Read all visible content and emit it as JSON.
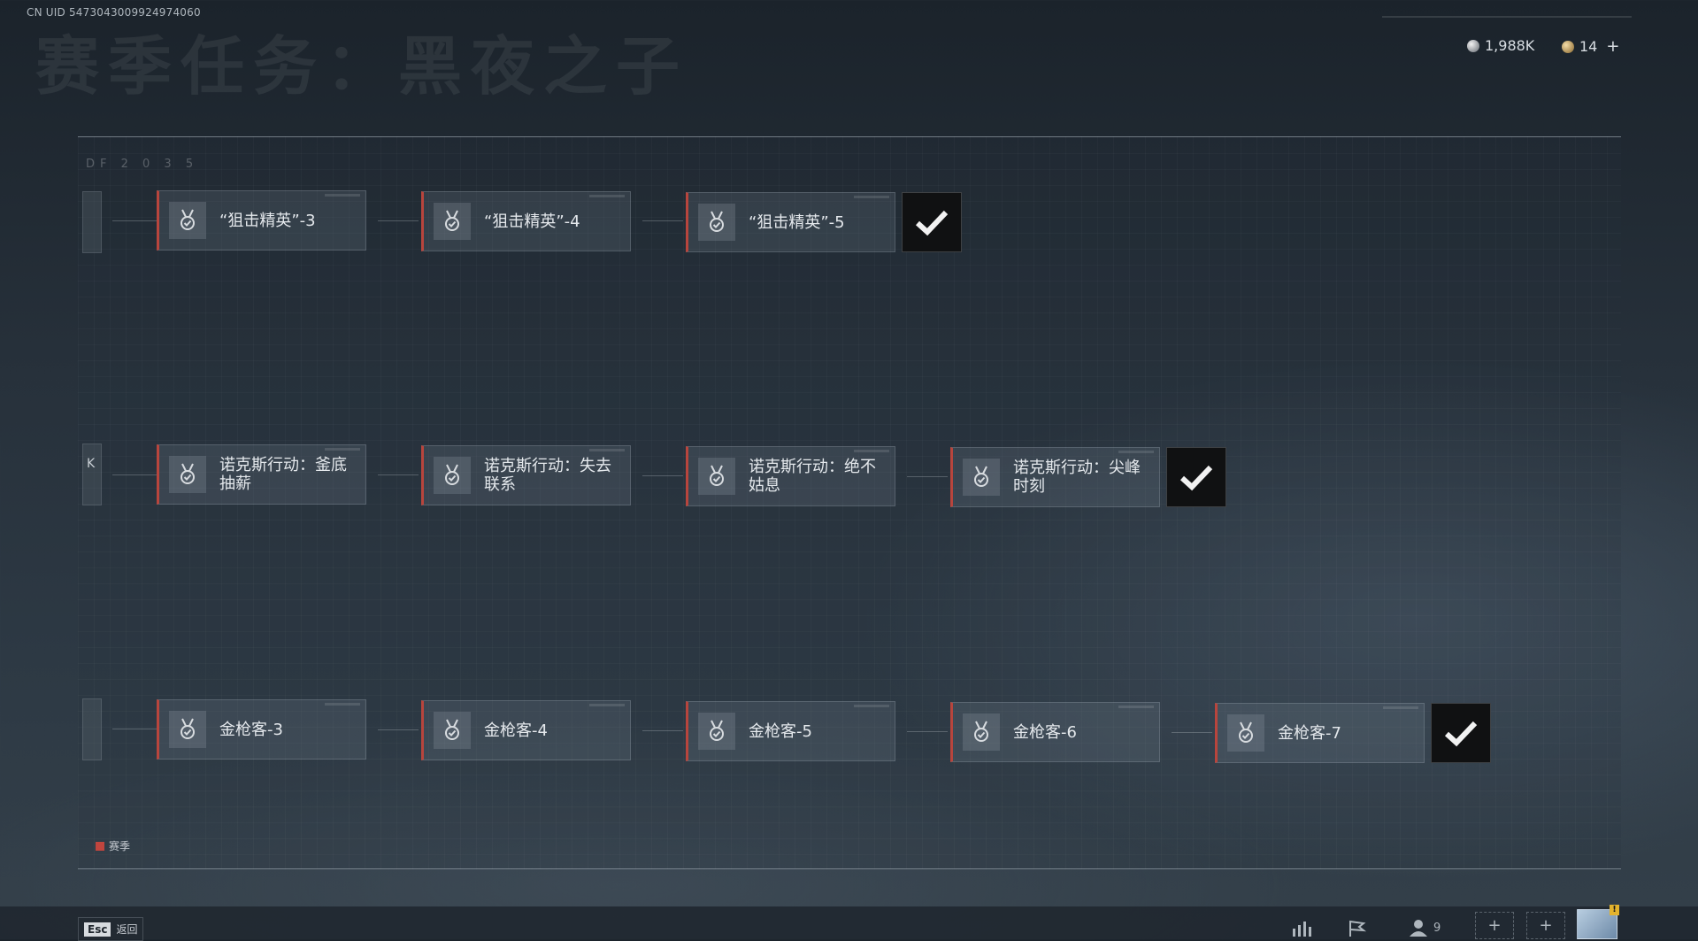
{
  "header": {
    "uid": "CN UID 5473043009924974060",
    "title": "赛季任务：黑夜之子",
    "currency": [
      {
        "icon": "silver-coin-icon",
        "value": "1,988K"
      },
      {
        "icon": "gold-coin-icon",
        "value": "14",
        "add": "+"
      }
    ]
  },
  "panel": {
    "df_code": "DF 2 0 3 5"
  },
  "rows": [
    {
      "stub": "",
      "tasks": [
        {
          "label": "“狙击精英”-3",
          "icon": "medal-check-icon"
        },
        {
          "label": "“狙击精英”-4",
          "icon": "medal-check-icon"
        },
        {
          "label": "“狙击精英”-5",
          "icon": "medal-check-icon"
        }
      ],
      "completed_icon": "checkmark-icon"
    },
    {
      "stub": "K",
      "tasks": [
        {
          "label": "诺克斯行动：釜底抽薪",
          "icon": "medal-check-icon"
        },
        {
          "label": "诺克斯行动：失去联系",
          "icon": "medal-check-icon"
        },
        {
          "label": "诺克斯行动：绝不姑息",
          "icon": "medal-check-icon"
        },
        {
          "label": "诺克斯行动：尖峰时刻",
          "icon": "medal-check-icon"
        }
      ],
      "completed_icon": "checkmark-icon"
    },
    {
      "stub": "",
      "tasks": [
        {
          "label": "金枪客-3",
          "icon": "medal-check-icon"
        },
        {
          "label": "金枪客-4",
          "icon": "medal-check-icon"
        },
        {
          "label": "金枪客-5",
          "icon": "medal-check-icon"
        },
        {
          "label": "金枪客-6",
          "icon": "medal-check-icon"
        },
        {
          "label": "金枪客-7",
          "icon": "medal-check-icon"
        }
      ],
      "completed_icon": "checkmark-icon"
    }
  ],
  "legend": {
    "label": "赛季",
    "color": "#c0453e"
  },
  "footer": {
    "esc_key": "Esc",
    "esc_label": "返回",
    "friends_count": "9",
    "add_label": "+",
    "avatar_badge": "!"
  },
  "colors": {
    "accent": "#b8453d",
    "check_bg": "#101112"
  }
}
